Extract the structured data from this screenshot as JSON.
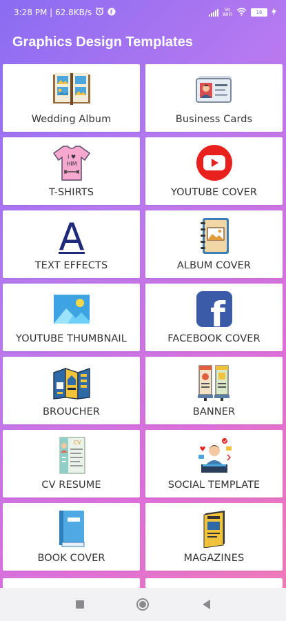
{
  "status": {
    "time_speed": "3:28 PM | 62.8KB/s",
    "vowifi_top": "Vo",
    "vowifi_bottom": "WiFi",
    "battery": "16"
  },
  "app": {
    "title": "Graphics Design Templates"
  },
  "cards": [
    {
      "label": "Wedding Album",
      "icon": "wedding-album-icon"
    },
    {
      "label": "Business Cards",
      "icon": "business-card-icon"
    },
    {
      "label": "T-SHIRTS",
      "icon": "tshirt-icon",
      "icon_text_1": "I ♥",
      "icon_text_2": "HIM"
    },
    {
      "label": "YOUTUBE COVER",
      "icon": "youtube-icon"
    },
    {
      "label": "TEXT EFFECTS",
      "icon": "letter-a-icon",
      "icon_text": "A"
    },
    {
      "label": "ALBUM COVER",
      "icon": "album-notebook-icon"
    },
    {
      "label": "YOUTUBE THUMBNAIL",
      "icon": "image-thumbnail-icon"
    },
    {
      "label": "FACEBOOK COVER",
      "icon": "facebook-icon",
      "icon_text": "f"
    },
    {
      "label": "BROUCHER",
      "icon": "brochure-icon"
    },
    {
      "label": "BANNER",
      "icon": "banner-icon"
    },
    {
      "label": "CV RESUME",
      "icon": "cv-resume-icon",
      "icon_text": "CV"
    },
    {
      "label": "SOCIAL TEMPLATE",
      "icon": "social-media-icon"
    },
    {
      "label": "BOOK COVER",
      "icon": "book-icon"
    },
    {
      "label": "MAGAZINES",
      "icon": "magazine-icon"
    }
  ],
  "colors": {
    "youtube_red": "#e8211e",
    "facebook_blue": "#3b5ba8",
    "text_dark": "#333333"
  }
}
